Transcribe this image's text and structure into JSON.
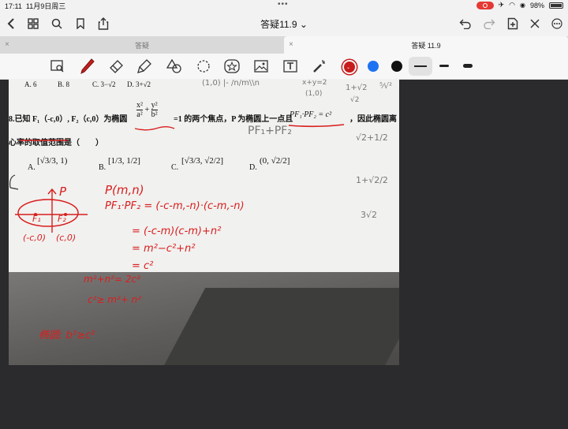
{
  "status": {
    "time": "17:11",
    "date": "11月9日周三",
    "battery": "98%"
  },
  "nav": {
    "title": "答疑11.9",
    "chevron": "⌄"
  },
  "tabs": [
    {
      "label": "答疑",
      "close": "×",
      "active": false
    },
    {
      "label": "答疑 11.9",
      "close": "×",
      "active": true
    }
  ],
  "toolbar": {
    "tools": [
      "zoom-image-icon",
      "pen-icon",
      "eraser-icon",
      "highlighter-icon",
      "shapes-icon",
      "lasso-icon",
      "sticker-icon",
      "image-icon",
      "text-icon",
      "laser-icon"
    ],
    "colors": [
      "#c71c1c",
      "#1d72f2",
      "#111111"
    ]
  },
  "doc": {
    "top_options": [
      "A. 6",
      "B. 8",
      "C. 3−√2",
      "D. 3+√2"
    ],
    "question_prefix": "8.已知 F₁（-c,0）, F₂（c,0）为椭圆",
    "question_mid": "=1 的两个焦点，P 为椭圆上一点且",
    "question_end": "，因此椭圆离",
    "question_line2": "心率的取值范围是（　　）",
    "options": [
      "A.",
      "B.",
      "C.",
      "D."
    ],
    "gray_notes": [
      "x+y=2",
      "(1,0)",
      "1+√2",
      "√2",
      "PF₁+PF₂",
      "√2+1/2",
      "1+√2/2",
      "3√2"
    ],
    "handwriting": {
      "p": "P",
      "pmn": "P(m,n)",
      "dot": "PF₁·PF₂ = (-c-m,-n)·(c-m,-n)",
      "s1": "= (-c-m)(c-m)+n²",
      "s2": "= m²−c²+n²",
      "s3": "= c²",
      "f1": "F₁",
      "f2": "F₂",
      "l1": "(-c,0)",
      "l2": "(c,0)",
      "b1": "m²+n²= 2c²",
      "b2": "c²≥ m²+ n²",
      "b3": "椭圆: b²≥c²"
    }
  }
}
